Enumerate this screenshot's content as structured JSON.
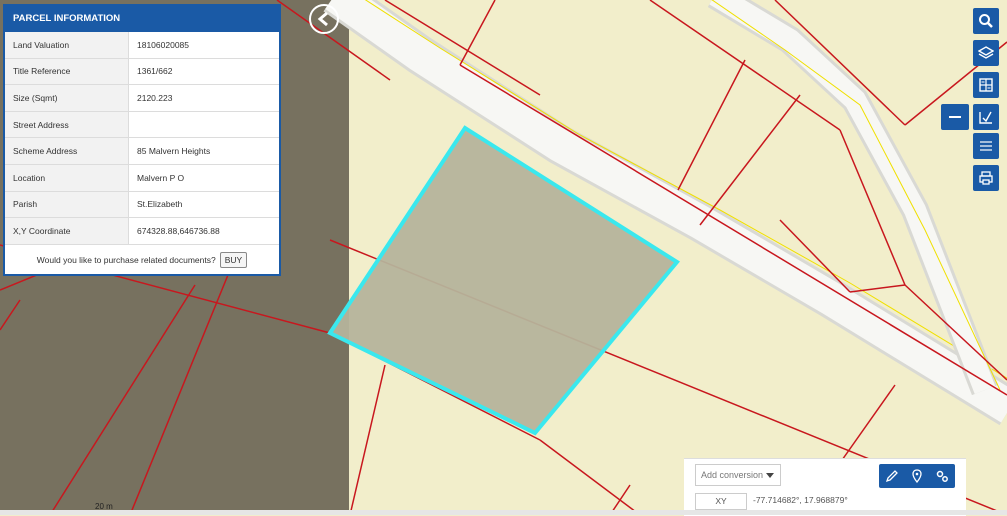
{
  "panel": {
    "title": "PARCEL INFORMATION",
    "rows": [
      {
        "label": "Land Valuation",
        "value": "18106020085"
      },
      {
        "label": "Title Reference",
        "value": "1361/662"
      },
      {
        "label": "Size (Sqmt)",
        "value": "2120.223"
      },
      {
        "label": "Street Address",
        "value": ""
      },
      {
        "label": "Scheme Address",
        "value": "85 Malvern Heights"
      },
      {
        "label": "Location",
        "value": "Malvern P O"
      },
      {
        "label": "Parish",
        "value": "St.Elizabeth"
      },
      {
        "label": "X,Y Coordinate",
        "value": "674328.88,646736.88"
      }
    ],
    "purchase_prompt": "Would you like to purchase related documents?",
    "buy_label": "BUY"
  },
  "map": {
    "scale_label": "20 m",
    "colors": {
      "land": "#f2eecb",
      "boundary": "#c8171e",
      "road": "#f7f7f4",
      "road_centerline": "#f0e000",
      "selected_outline": "#3ae8ee",
      "selected_fill": "#b5b39b",
      "imagery_overlay": "#77715f"
    }
  },
  "toolbar": {
    "icons": [
      "search-icon",
      "layers-icon",
      "calculator-icon",
      "collapse-icon",
      "measure-icon",
      "list-icon",
      "print-icon"
    ]
  },
  "coords": {
    "conversion_placeholder": "Add conversion",
    "xy_label": "XY",
    "value": "-77.714682°, 17.968879°",
    "tools": [
      "pencil-icon",
      "location-marker-icon",
      "settings-icon"
    ]
  }
}
